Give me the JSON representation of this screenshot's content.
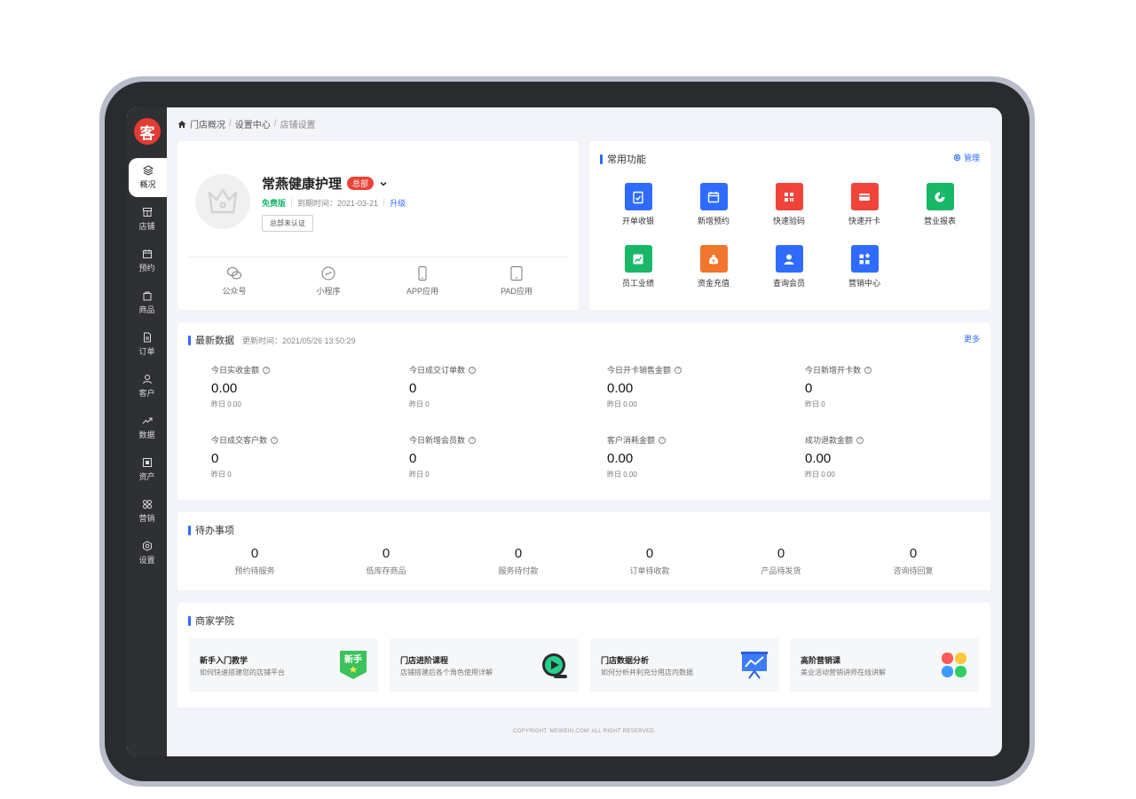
{
  "sidebar": {
    "logo": "客",
    "items": [
      {
        "label": "概况",
        "icon": "layers-icon",
        "active": true
      },
      {
        "label": "店铺",
        "icon": "store-icon"
      },
      {
        "label": "预约",
        "icon": "calendar-icon"
      },
      {
        "label": "商品",
        "icon": "bag-icon"
      },
      {
        "label": "订单",
        "icon": "document-icon"
      },
      {
        "label": "客户",
        "icon": "user-icon"
      },
      {
        "label": "数据",
        "icon": "trend-icon"
      },
      {
        "label": "资产",
        "icon": "asset-icon"
      },
      {
        "label": "营销",
        "icon": "grid-icon"
      },
      {
        "label": "设置",
        "icon": "gear-icon"
      }
    ]
  },
  "breadcrumb": {
    "home": "门店概况",
    "mid": "设置中心",
    "current": "店铺设置",
    "sep": "/"
  },
  "store": {
    "name": "常燕健康护理",
    "badge": "总部",
    "plan": "免费版",
    "expire_label": "到期时间：2021-03-21",
    "upgrade": "升级",
    "cert_button": "总部未认证",
    "channels": [
      "公众号",
      "小程序",
      "APP应用",
      "PAD应用"
    ]
  },
  "functions": {
    "title": "常用功能",
    "manage": "管理",
    "items": [
      {
        "label": "开单收银",
        "color": "#2f6bff",
        "icon": "clipboard-icon"
      },
      {
        "label": "新增预约",
        "color": "#2f6bff",
        "icon": "calendar-icon"
      },
      {
        "label": "快速验码",
        "color": "#f0443a",
        "icon": "grid-icon"
      },
      {
        "label": "快速开卡",
        "color": "#f0443a",
        "icon": "card-icon"
      },
      {
        "label": "营业报表",
        "color": "#19b868",
        "icon": "pie-icon"
      },
      {
        "label": "员工业绩",
        "color": "#19b868",
        "icon": "chart-icon"
      },
      {
        "label": "资金充值",
        "color": "#f2752d",
        "icon": "money-bag-icon"
      },
      {
        "label": "查询会员",
        "color": "#2f6bff",
        "icon": "member-icon"
      },
      {
        "label": "营销中心",
        "color": "#2f6bff",
        "icon": "blocks-icon"
      }
    ]
  },
  "latest": {
    "title": "最新数据",
    "updated": "更新时间：2021/05/26 13:50:29",
    "more": "更多",
    "stats": [
      {
        "label": "今日实收金额",
        "value": "0.00",
        "prev": "昨日 0.00"
      },
      {
        "label": "今日成交订单数",
        "value": "0",
        "prev": "昨日 0"
      },
      {
        "label": "今日开卡销售金额",
        "value": "0.00",
        "prev": "昨日 0.00"
      },
      {
        "label": "今日新增开卡数",
        "value": "0",
        "prev": "昨日 0"
      },
      {
        "label": "今日成交客户数",
        "value": "0",
        "prev": "昨日 0"
      },
      {
        "label": "今日新增会员数",
        "value": "0",
        "prev": "昨日 0"
      },
      {
        "label": "客户消耗金额",
        "value": "0.00",
        "prev": "昨日 0.00"
      },
      {
        "label": "成功退款金额",
        "value": "0.00",
        "prev": "昨日 0.00"
      }
    ]
  },
  "todo": {
    "title": "待办事项",
    "items": [
      {
        "count": "0",
        "label": "预约待服务"
      },
      {
        "count": "0",
        "label": "低库存商品"
      },
      {
        "count": "0",
        "label": "服务待付款"
      },
      {
        "count": "0",
        "label": "订单待收款"
      },
      {
        "count": "0",
        "label": "产品待发货"
      },
      {
        "count": "0",
        "label": "咨询待回复"
      }
    ]
  },
  "academy": {
    "title": "商家学院",
    "courses": [
      {
        "title": "新手入门教学",
        "desc": "如何快速搭建您的店铺平台",
        "icon_text": "新手"
      },
      {
        "title": "门店进阶课程",
        "desc": "店铺搭建后各个角色使用详解"
      },
      {
        "title": "门店数据分析",
        "desc": "如何分析并利充分用店内数据"
      },
      {
        "title": "高阶营销课",
        "desc": "美业活动营销讲师在线讲解"
      }
    ]
  },
  "footer": "COPYRIGHT 'MEIKEIN.COM' ALL RIGHT RESERVED."
}
